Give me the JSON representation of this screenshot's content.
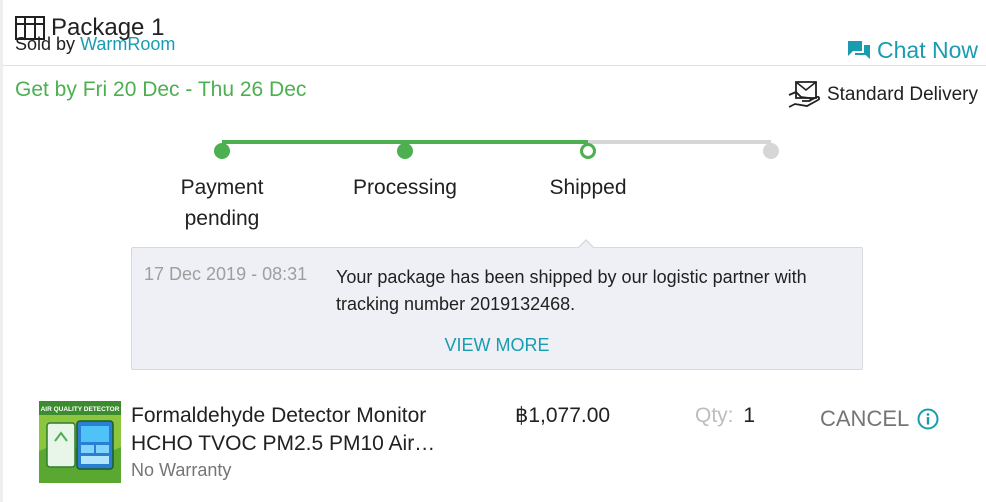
{
  "package": {
    "title": "Package 1",
    "sold_by_label": "Sold by",
    "seller": "WarmRoom",
    "chat_label": "Chat Now",
    "eta": "Get by Fri 20 Dec - Thu 26 Dec",
    "delivery_type": "Standard Delivery"
  },
  "tracker": {
    "steps": [
      {
        "label_line1": "Payment",
        "label_line2": "pending",
        "state": "done"
      },
      {
        "label_line1": "Processing",
        "label_line2": "",
        "state": "done"
      },
      {
        "label_line1": "Shipped",
        "label_line2": "",
        "state": "current"
      },
      {
        "label_line1": "",
        "label_line2": "",
        "state": "todo"
      }
    ]
  },
  "tracking_info": {
    "timestamp": "17 Dec 2019 - 08:31",
    "message": "Your package has been shipped by our logistic partner with tracking number 2019132468.",
    "view_more_label": "VIEW MORE"
  },
  "item": {
    "name_line1": "Formaldehyde Detector Monitor",
    "name_line2": "HCHO TVOC PM2.5 PM10 Air…",
    "thumbnail_caption": "AIR QUALITY DETECTOR",
    "warranty": "No Warranty",
    "price": "฿1,077.00",
    "qty_label": "Qty:",
    "qty_value": "1",
    "cancel_label": "CANCEL"
  },
  "colors": {
    "accent": "#1a9cb0",
    "success": "#4caf50",
    "pending": "#d6d6d6"
  },
  "icons": {
    "package": "package-icon",
    "chat": "chat-bubbles-icon",
    "delivery": "delivery-box-icon",
    "info": "info-circle-icon"
  }
}
